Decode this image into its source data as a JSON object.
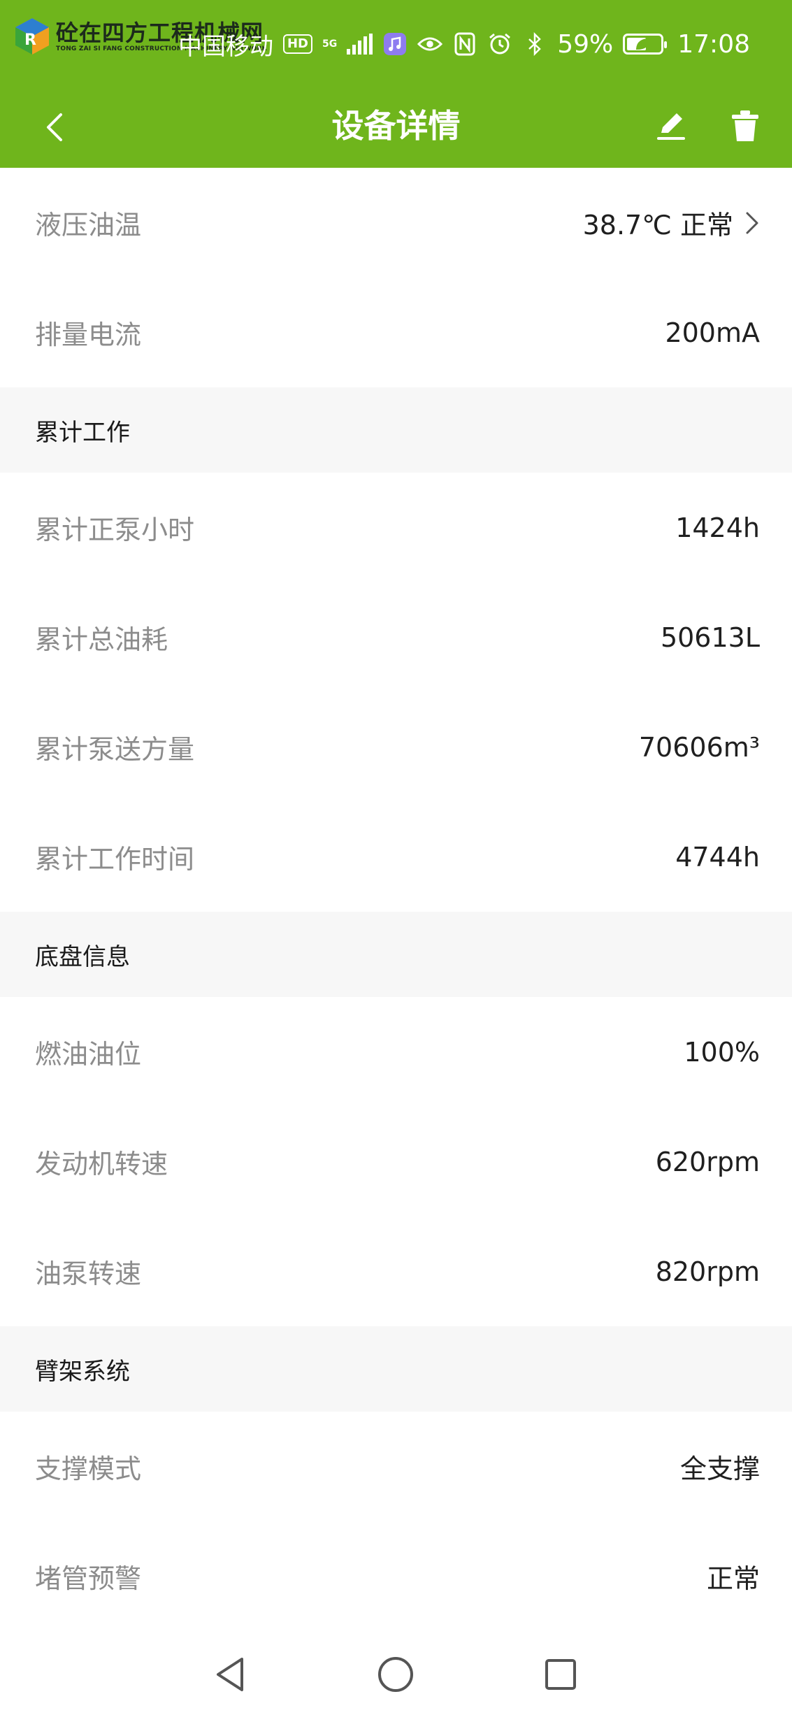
{
  "watermark": {
    "title": "砼在四方工程机械网",
    "subtitle": "TONG ZAI SI FANG CONSTRUCTION MACHINERY NETWORK"
  },
  "status_bar": {
    "carrier": "中国移动",
    "hd_badge": "HD",
    "network": "5G",
    "battery": "59%",
    "battery_level": 0.59,
    "time": "17:08",
    "icons": [
      "music-app-icon",
      "eye-icon",
      "nfc-icon",
      "alarm-icon",
      "bluetooth-icon",
      "battery-icon",
      "leaf-icon"
    ]
  },
  "header": {
    "title": "设备详情",
    "back_icon": "chevron-left-icon",
    "edit_icon": "pencil-icon",
    "delete_icon": "trash-icon",
    "background": "#6fb51c"
  },
  "rows_top": [
    {
      "label": "液压油温",
      "value": "38.7℃ 正常",
      "has_chevron": true
    },
    {
      "label": "排量电流",
      "value": "200mA"
    }
  ],
  "sections": [
    {
      "title": "累计工作",
      "rows": [
        {
          "label": "累计正泵小时",
          "value": "1424h"
        },
        {
          "label": "累计总油耗",
          "value": "50613L"
        },
        {
          "label": "累计泵送方量",
          "value": "70606m³"
        },
        {
          "label": "累计工作时间",
          "value": "4744h"
        }
      ]
    },
    {
      "title": "底盘信息",
      "rows": [
        {
          "label": "燃油油位",
          "value": "100%"
        },
        {
          "label": "发动机转速",
          "value": "620rpm"
        },
        {
          "label": "油泵转速",
          "value": "820rpm"
        }
      ]
    },
    {
      "title": "臂架系统",
      "rows": [
        {
          "label": "支撑模式",
          "value": "全支撑"
        },
        {
          "label": "堵管预警",
          "value": "正常"
        }
      ]
    }
  ],
  "nav_bar": {
    "icons": [
      "back-triangle-icon",
      "home-circle-icon",
      "recents-square-icon"
    ]
  }
}
